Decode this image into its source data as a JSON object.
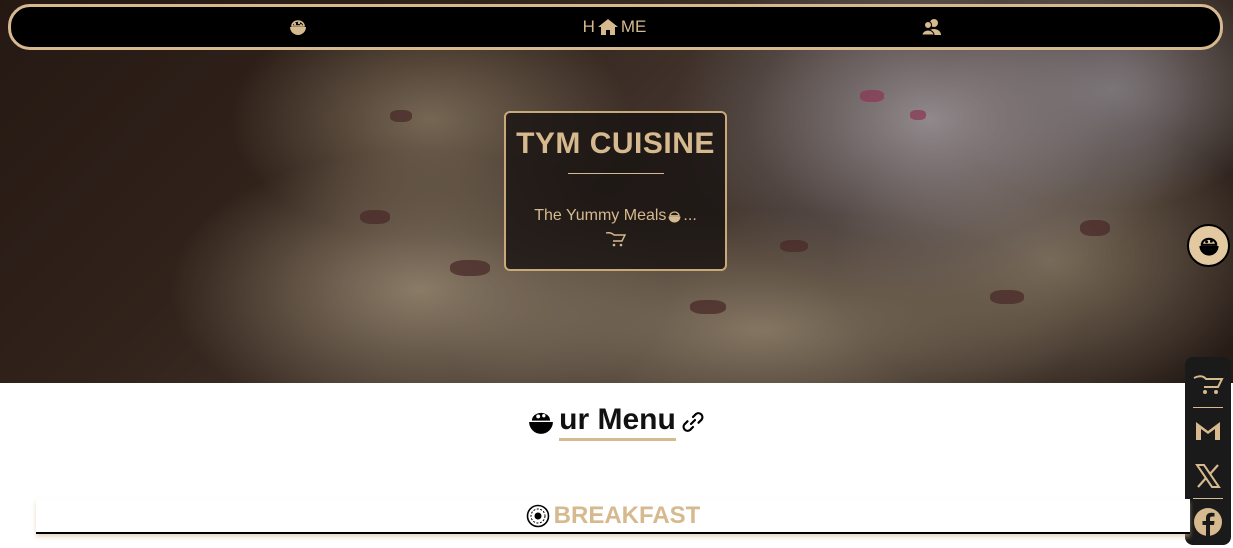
{
  "nav": {
    "home_label_pre": "H",
    "home_label_post": "ME",
    "icons": [
      "bowl-icon",
      "home-house-icon",
      "users-icon"
    ]
  },
  "hero": {
    "title": "TYM CUISINE",
    "tagline_pre": "The Yummy Meals",
    "tagline_post": "...",
    "tagline_icon": "bowl-icon",
    "cart_icon": "cart-icon"
  },
  "social": [
    "cart-icon",
    "gmail-icon",
    "x-icon",
    "facebook-icon"
  ],
  "menu": {
    "heading_word": "ur Menu",
    "heading_icons": [
      "bowl-icon",
      "link-icon"
    ]
  },
  "sections": [
    {
      "label": "BREAKFAST",
      "icon": "breakfast-emblem-icon"
    }
  ],
  "colors": {
    "accent": "#d6b98e",
    "navbar_bg": "#000000",
    "card_bg": "#191412",
    "social_bg": "#1a1a1a"
  }
}
